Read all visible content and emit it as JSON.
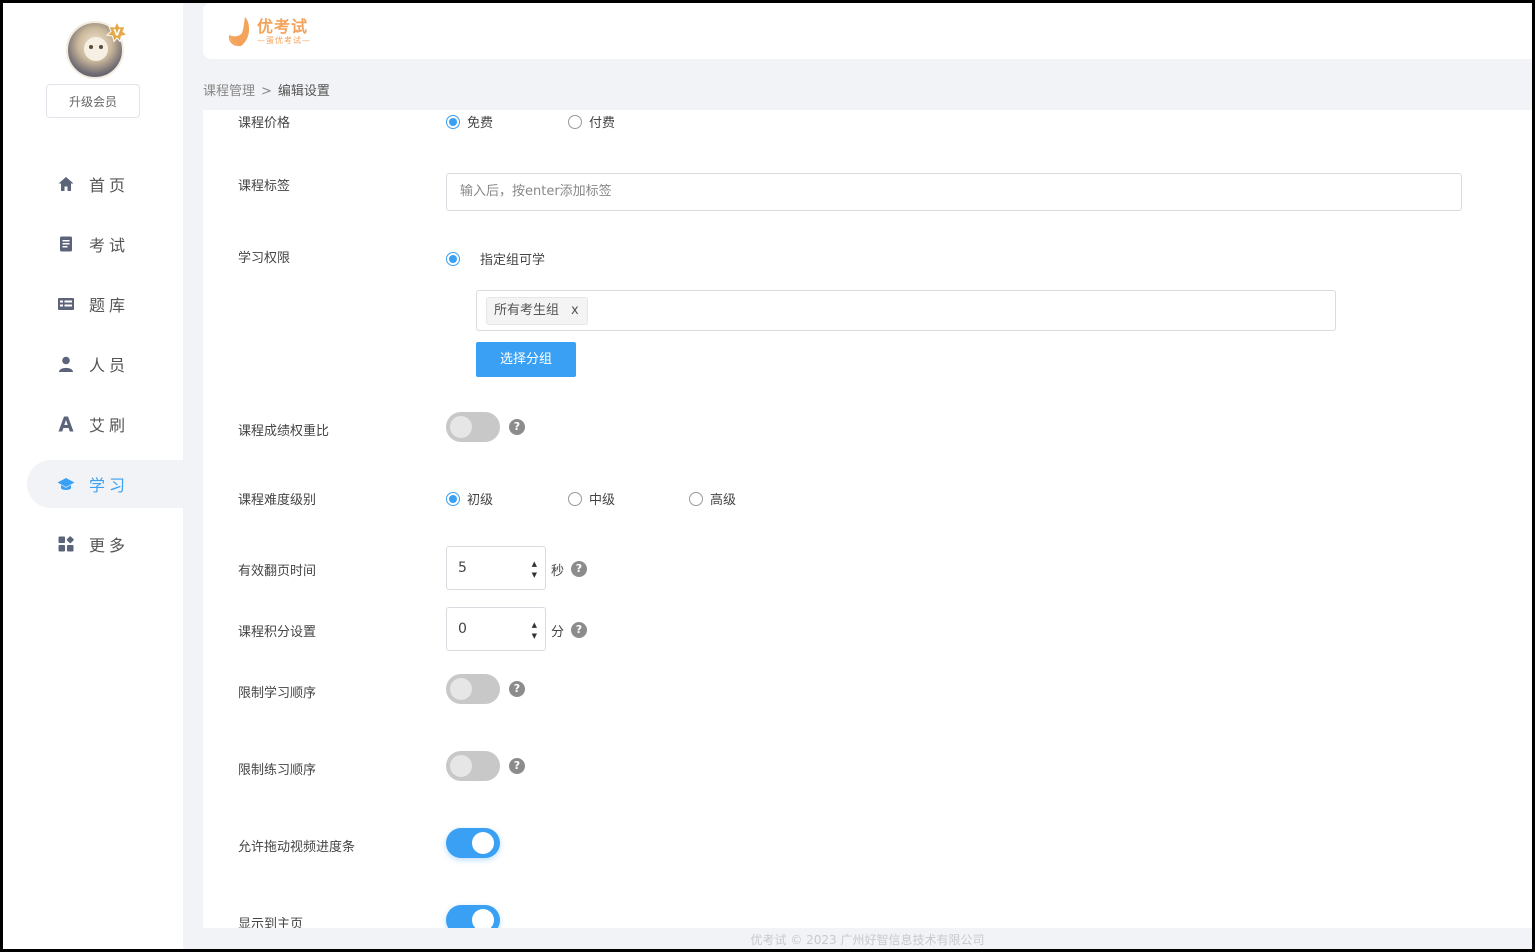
{
  "sidebar": {
    "upgrade_label": "升级会员",
    "items": [
      {
        "label": "首页",
        "icon": "home-icon"
      },
      {
        "label": "考试",
        "icon": "exam-icon"
      },
      {
        "label": "题库",
        "icon": "question-bank-icon"
      },
      {
        "label": "人员",
        "icon": "person-icon"
      },
      {
        "label": "艾刷",
        "icon": "ai-icon"
      },
      {
        "label": "学习",
        "icon": "graduation-cap-icon",
        "active": true
      },
      {
        "label": "更多",
        "icon": "more-apps-icon"
      }
    ]
  },
  "header": {
    "logo_name": "优考试",
    "logo_sub": "—蛋优考试—"
  },
  "breadcrumb": {
    "parent": "课程管理",
    "separator": ">",
    "current": "编辑设置"
  },
  "form": {
    "price": {
      "label": "课程价格",
      "options": [
        "免费",
        "付费"
      ],
      "selected": "免费"
    },
    "tags": {
      "label": "课程标签",
      "placeholder": "输入后，按enter添加标签"
    },
    "permission": {
      "label": "学习权限",
      "option": "指定组可学",
      "chip": "所有考生组",
      "chip_close": "x",
      "select_button": "选择分组"
    },
    "score_weight": {
      "label": "课程成绩权重比",
      "on": false
    },
    "difficulty": {
      "label": "课程难度级别",
      "options": [
        "初级",
        "中级",
        "高级"
      ],
      "selected": "初级"
    },
    "page_time": {
      "label": "有效翻页时间",
      "value": "5",
      "unit": "秒"
    },
    "points": {
      "label": "课程积分设置",
      "value": "0",
      "unit": "分"
    },
    "limit_study_order": {
      "label": "限制学习顺序",
      "on": false
    },
    "limit_practice_order": {
      "label": "限制练习顺序",
      "on": false
    },
    "allow_drag_video": {
      "label": "允许拖动视频进度条",
      "on": true
    },
    "show_on_home": {
      "label": "显示到主页",
      "on": true
    },
    "help_glyph": "?"
  },
  "footer": {
    "text": "优考试 © 2023 广州好智信息技术有限公司"
  },
  "colors": {
    "accent": "#3aa0f3",
    "logo": "#f4a35a",
    "background": "#f2f3f6"
  }
}
